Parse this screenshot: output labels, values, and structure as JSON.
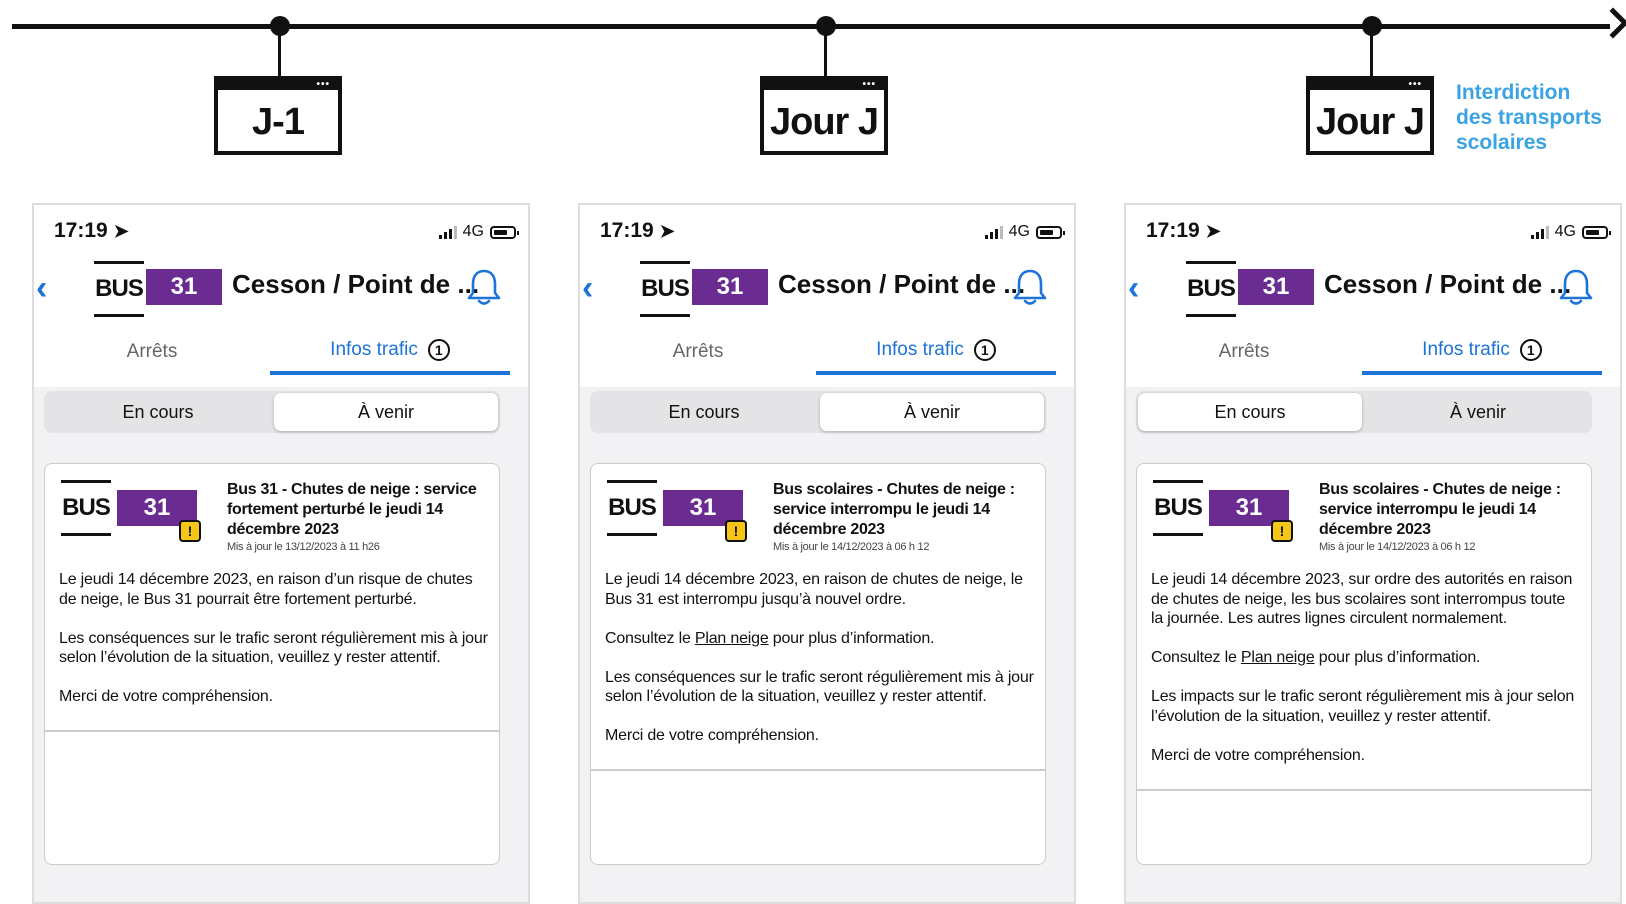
{
  "timeline": {
    "stages": [
      {
        "label": "J-1"
      },
      {
        "label": "Jour J"
      },
      {
        "label": "Jour J",
        "note": [
          "Interdiction",
          "des transports",
          "scolaires"
        ]
      }
    ]
  },
  "status_bar": {
    "time": "17:19",
    "network": "4G"
  },
  "header": {
    "bus_word": "BUS",
    "line_number": "31",
    "title": "Cesson / Point de ..."
  },
  "tabs": {
    "stops": "Arrêts",
    "traffic": "Infos trafic",
    "traffic_count": "1"
  },
  "segments": {
    "current": "En cours",
    "upcoming": "À venir"
  },
  "icons": {
    "back": "chevron-left-icon",
    "bell": "bell-icon",
    "warning": "warning-icon",
    "location": "location-arrow-icon"
  },
  "colors": {
    "line_badge": "#6a2c91",
    "accent": "#1d73d8",
    "note": "#3aa3e3",
    "warning": "#f5c518"
  },
  "panels": [
    {
      "selected_segment": "upcoming",
      "message": {
        "title": "Bus 31 - Chutes de neige : service fortement perturbé le jeudi 14 décembre 2023",
        "updated": "Mis à jour le 13/12/2023 à 11 h26",
        "paragraphs": [
          "Le jeudi 14 décembre 2023, en raison d’un risque de chutes de neige, le Bus 31 pourrait être fortement perturbé.",
          "Les conséquences sur le trafic seront régulièrement mis à jour selon l’évolution de la situation, veuillez y rester attentif.",
          "Merci de votre compréhension."
        ]
      }
    },
    {
      "selected_segment": "upcoming",
      "message": {
        "title": "Bus scolaires - Chutes de neige : service interrompu le jeudi 14 décembre 2023",
        "updated": "Mis à jour le 14/12/2023 à 06 h 12",
        "paragraphs": [
          "Le jeudi 14 décembre 2023, en raison de chutes de neige, le Bus 31 est interrompu jusqu’à nouvel ordre.",
          "Consultez le |Plan neige| pour plus d’information.",
          "Les conséquences sur le trafic seront régulièrement mis à jour selon l’évolution de la situation, veuillez y rester attentif.",
          "Merci de votre compréhension."
        ]
      }
    },
    {
      "selected_segment": "current",
      "message": {
        "title": "Bus scolaires - Chutes de neige : service interrompu le jeudi 14 décembre 2023",
        "updated": "Mis à jour le 14/12/2023 à 06 h 12",
        "paragraphs": [
          "Le jeudi 14 décembre 2023, sur ordre des autorités en raison de chutes de neige, les bus scolaires sont interrompus toute la journée. Les autres lignes circulent normalement.",
          "Consultez le |Plan neige| pour plus d’information.",
          "Les impacts sur le trafic seront régulièrement mis à jour selon l’évolution de la situation, veuillez y rester attentif.",
          "Merci de votre compréhension."
        ]
      }
    }
  ]
}
